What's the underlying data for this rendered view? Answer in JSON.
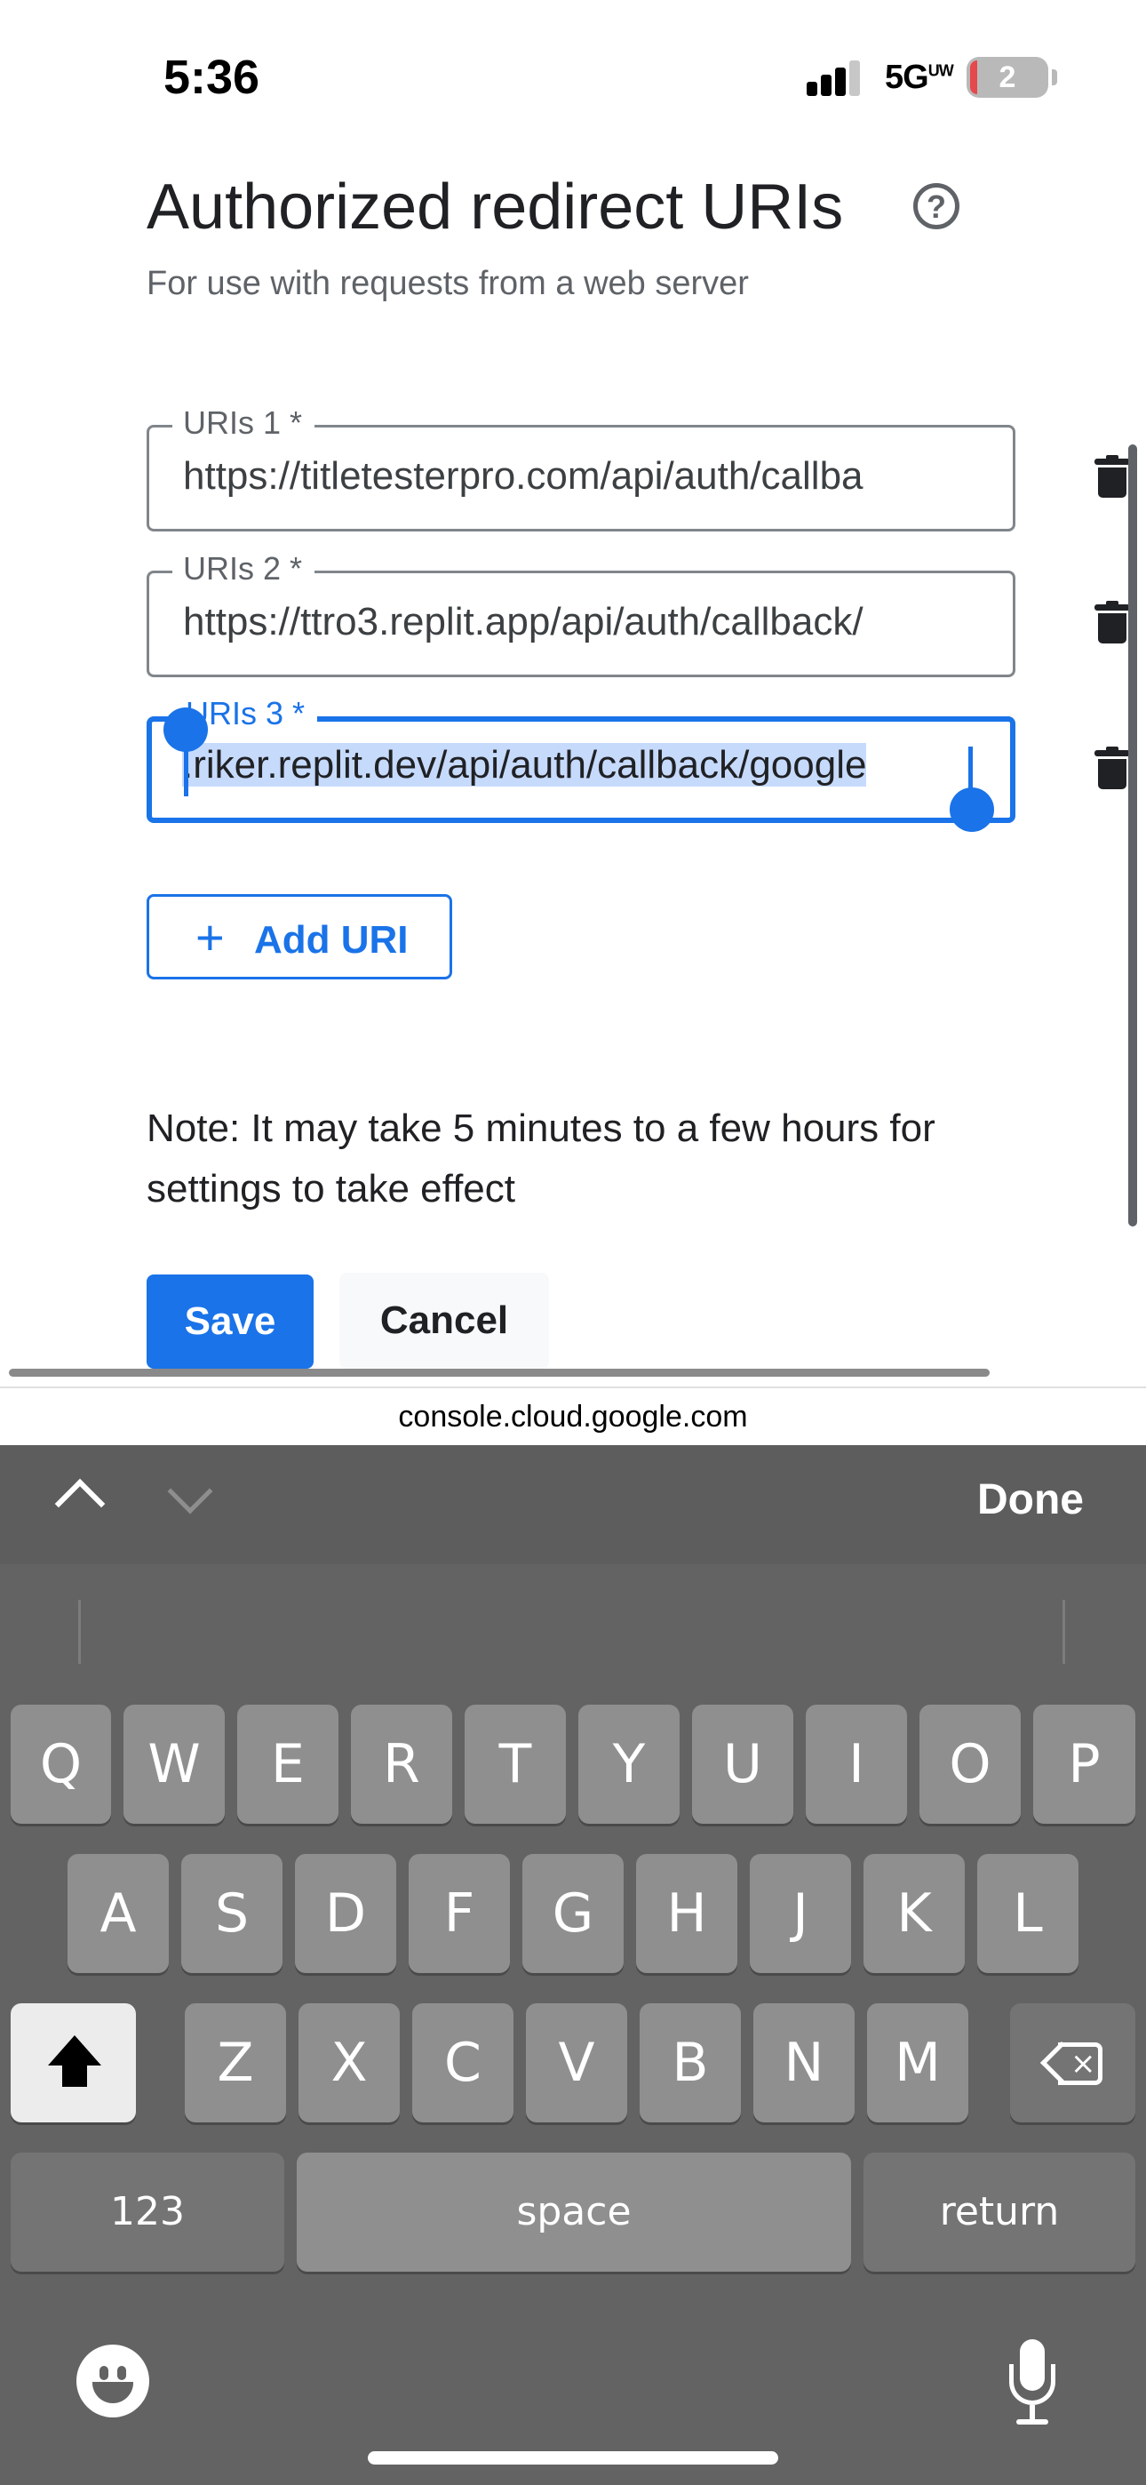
{
  "status_bar": {
    "time": "5:36",
    "network": "5G",
    "network_suffix": "UW",
    "battery": "2"
  },
  "page": {
    "title": "Authorized redirect URIs",
    "subtitle": "For use with requests from a web server",
    "help_icon": "?",
    "uris": [
      {
        "label": "URIs 1 *",
        "value": "https://titletesterpro.com/api/auth/callba"
      },
      {
        "label": "URIs 2 *",
        "value": "https://ttro3.replit.app/api/auth/callback/"
      },
      {
        "label": "URIs 3 *",
        "value": ".riker.replit.dev/api/auth/callback/google"
      }
    ],
    "add_uri_label": "Add URI",
    "add_uri_icon": "+",
    "note": "Note: It may take 5 minutes to a few hours for settings to take effect",
    "save_label": "Save",
    "cancel_label": "Cancel",
    "accent_color": "#1a73e8"
  },
  "browser": {
    "url": "console.cloud.google.com"
  },
  "keyboard": {
    "done_label": "Done",
    "row1": [
      "Q",
      "W",
      "E",
      "R",
      "T",
      "Y",
      "U",
      "I",
      "O",
      "P"
    ],
    "row2": [
      "A",
      "S",
      "D",
      "F",
      "G",
      "H",
      "J",
      "K",
      "L"
    ],
    "row3": [
      "Z",
      "X",
      "C",
      "V",
      "B",
      "N",
      "M"
    ],
    "numbers_label": "123",
    "space_label": "space",
    "return_label": "return"
  }
}
